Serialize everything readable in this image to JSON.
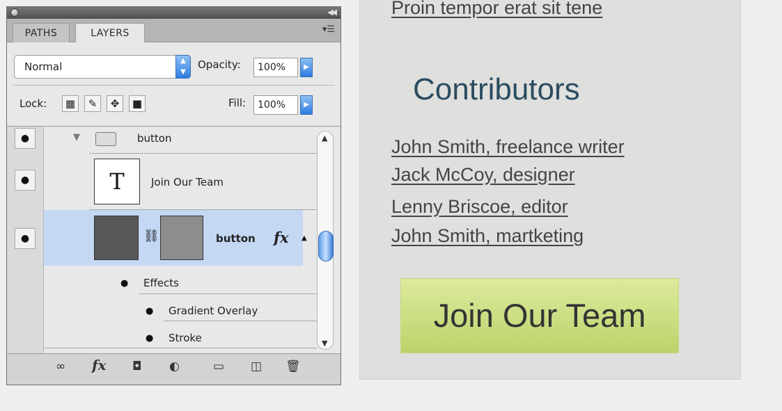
{
  "panel": {
    "tabs": [
      "PATHS",
      "LAYERS"
    ],
    "active_tab": "LAYERS",
    "blend_mode": "Normal",
    "opacity_label": "Opacity:",
    "opacity_value": "100%",
    "lock_label": "Lock:",
    "fill_label": "Fill:",
    "fill_value": "100%",
    "layers": {
      "group_name": "button",
      "text_layer_name": "Join Our Team",
      "text_thumb_glyph": "T",
      "selected_layer_name": "button",
      "fx_badge": "fx",
      "effects_label": "Effects",
      "effect_items": [
        "Gradient Overlay",
        "Stroke"
      ]
    },
    "bottom_icons": [
      "link-icon",
      "fx-icon",
      "mask-icon",
      "adjustment-icon",
      "folder-icon",
      "new-layer-icon",
      "trash-icon"
    ]
  },
  "page": {
    "top_link": "Proin tempor erat sit tene",
    "contributors_title": "Contributors",
    "contributors": [
      "John Smith, freelance writer",
      "Jack McCoy, designer",
      "Lenny Briscoe, editor",
      "John Smith, martketing"
    ],
    "join_button": "Join Our Team"
  },
  "colors": {
    "selected_row": "#c4d8f4",
    "heading": "#2b4c60",
    "button_green": "#c9dc7e"
  }
}
